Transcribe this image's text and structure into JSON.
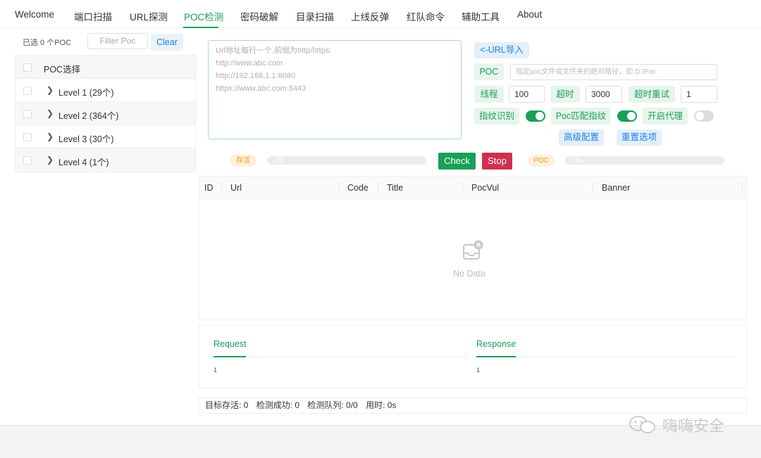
{
  "nav": {
    "items": [
      "Welcome",
      "端口扫描",
      "URL探测",
      "POC检测",
      "密码破解",
      "目录扫描",
      "上线反弹",
      "红队命令",
      "辅助工具",
      "About"
    ],
    "active": "POC检测"
  },
  "left": {
    "selected_count": "已选 0 个POC",
    "filter_placeholder": "Filter Poc",
    "clear_label": "Clear",
    "tree_header": "POC选择",
    "levels": [
      "Level 1 (29个)",
      "Level 2 (364个)",
      "Level 3 (30个)",
      "Level 4 (1个)"
    ]
  },
  "url_input": {
    "placeholder_lines": [
      "Url地址每行一个,前缀为http/https:",
      "http://www.abc.com",
      "http://192.168.1.1:8080",
      "https://www.abc.com:8443"
    ]
  },
  "config": {
    "url_import": "<-URL导入",
    "poc_label": "POC",
    "poc_path_placeholder": "指定poc文件或文件夹的绝对路径，如 D:\\Poc",
    "threads_label": "线程",
    "threads_value": "100",
    "timeout_label": "超时",
    "timeout_value": "3000",
    "retry_label": "超时重试",
    "retry_value": "1",
    "fingerprint_label": "指纹识别",
    "fingerprint_on": true,
    "poc_match_label": "Poc匹配指纹",
    "poc_match_on": true,
    "proxy_label": "开启代理",
    "proxy_on": false,
    "advanced_label": "高级配置",
    "reset_label": "重置选项"
  },
  "progress": {
    "alive_label": "存活",
    "alive_percent": "0%",
    "check_label": "Check",
    "stop_label": "Stop",
    "poc_label": "POC",
    "poc_percent": "0%"
  },
  "table": {
    "columns": [
      "ID",
      "Url",
      "Code",
      "Title",
      "PocVul",
      "Banner"
    ],
    "empty_text": "No Data"
  },
  "detail": {
    "request_label": "Request",
    "request_value": "1",
    "response_label": "Response",
    "response_value": "1"
  },
  "status": {
    "alive": "目标存活: 0",
    "success": "检测成功: 0",
    "queue": "检测队列: 0/0",
    "elapsed": "用时: 0s"
  },
  "watermark": "嗨嗨安全",
  "colors": {
    "accent": "#18a058",
    "blue": "#2080f0",
    "danger": "#d03050",
    "warning": "#f0a020"
  }
}
